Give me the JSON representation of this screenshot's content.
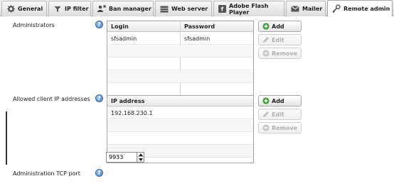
{
  "tabs": [
    {
      "label": "General",
      "icon": "gear-icon"
    },
    {
      "label": "IP filter",
      "icon": "funnel-icon"
    },
    {
      "label": "Ban manager",
      "icon": "ban-user-icon"
    },
    {
      "label": "Web server",
      "icon": "server-icon"
    },
    {
      "label": "Adobe Flash Player",
      "icon": "flash-icon"
    },
    {
      "label": "Mailer",
      "icon": "envelope-icon"
    },
    {
      "label": "Remote admin",
      "icon": "remote-admin-icon",
      "active": true
    }
  ],
  "administrators": {
    "label": "Administrators",
    "columns": [
      "Login",
      "Password"
    ],
    "rows": [
      {
        "login": "sfsadmin",
        "password": "sfsadmin"
      }
    ],
    "buttons": {
      "add": "Add",
      "edit": "Edit",
      "remove": "Remove"
    }
  },
  "allowed_ips": {
    "label": "Allowed client IP addresses",
    "columns": [
      "IP address"
    ],
    "rows": [
      "192.168.230.1"
    ],
    "buttons": {
      "add": "Add",
      "edit": "Edit",
      "remove": "Remove"
    }
  },
  "tcp_port": {
    "label": "Administration TCP port",
    "value": "9933"
  },
  "colors": {
    "add_icon": "#3f9a3a",
    "help_icon": "#4a7fc0",
    "disabled": "#b0b0b0"
  }
}
